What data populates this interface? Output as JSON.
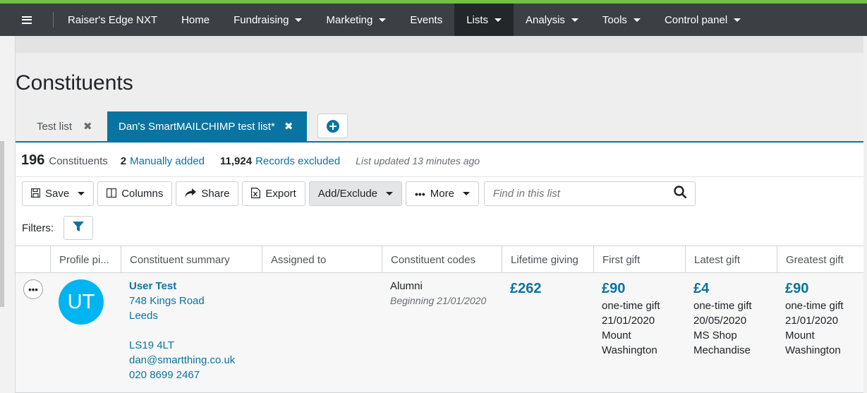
{
  "nav": {
    "brand": "Raiser's Edge NXT",
    "items": [
      {
        "label": "Home",
        "caret": false,
        "active": false
      },
      {
        "label": "Fundraising",
        "caret": true,
        "active": false
      },
      {
        "label": "Marketing",
        "caret": true,
        "active": false
      },
      {
        "label": "Events",
        "caret": false,
        "active": false
      },
      {
        "label": "Lists",
        "caret": true,
        "active": true
      },
      {
        "label": "Analysis",
        "caret": true,
        "active": false
      },
      {
        "label": "Tools",
        "caret": true,
        "active": false
      },
      {
        "label": "Control panel",
        "caret": true,
        "active": false
      }
    ]
  },
  "page": {
    "title": "Constituents",
    "tabs": [
      {
        "label": "Test list",
        "close": "✖"
      },
      {
        "label": "Dan's SmartMAILCHIMP test list*",
        "close": "✖"
      }
    ]
  },
  "summary": {
    "count": "196",
    "count_label": "Constituents",
    "manual_count": "2",
    "manual_label": "Manually added",
    "excluded_count": "11,924",
    "excluded_label": "Records excluded",
    "updated": "List updated 13 minutes ago"
  },
  "toolbar": {
    "save": "Save",
    "columns": "Columns",
    "share": "Share",
    "export": "Export",
    "add_exclude": "Add/Exclude",
    "more": "More",
    "search_placeholder": "Find in this list"
  },
  "filters": {
    "label": "Filters:"
  },
  "grid": {
    "columns": [
      "Profile pi...",
      "Constituent summary",
      "Assigned to",
      "Constituent codes",
      "Lifetime giving",
      "First gift",
      "Latest gift",
      "Greatest gift"
    ],
    "rows": [
      {
        "initials": "UT",
        "name": "User Test",
        "address1": "748 Kings Road",
        "city": "Leeds",
        "postcode": "LS19 4LT",
        "email": "dan@smartthing.co.uk",
        "phone": "020 8699 2467",
        "code": "Alumni",
        "code_date": "Beginning 21/01/2020",
        "lifetime": "£262",
        "first": {
          "amount": "£90",
          "type": "one-time gift",
          "date": "21/01/2020",
          "line1": "Mount",
          "line2": "Washington"
        },
        "latest": {
          "amount": "£4",
          "type": "one-time gift",
          "date": "20/05/2020",
          "line1": "MS Shop",
          "line2": "Mechandise"
        },
        "greatest": {
          "amount": "£90",
          "type": "one-time gift",
          "date": "21/01/2020",
          "line1": "Mount",
          "line2": "Washington"
        }
      }
    ]
  },
  "colors": {
    "nav_bg": "#3c4044",
    "accent_green": "#71bf44",
    "primary_blue": "#0974a1",
    "avatar": "#00b4f1"
  }
}
